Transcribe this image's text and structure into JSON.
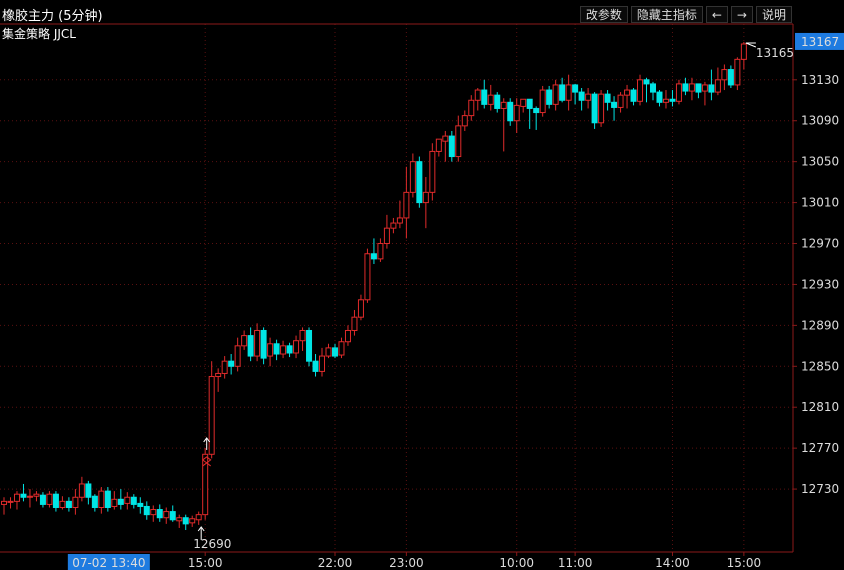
{
  "header": {
    "title": "橡胶主力 (5分钟)",
    "subtitle": "集金策略 JJCL",
    "buttons": [
      "改参数",
      "隐藏主指标",
      "←",
      "→",
      "说明"
    ]
  },
  "colors": {
    "up": "#e02b2b",
    "down": "#00e5e5",
    "axis": "#8b1a1a",
    "text": "#dddddd",
    "price_tag": "#1e7be0"
  },
  "chart_data": {
    "type": "candlestick",
    "y_ticks": [
      12730,
      12770,
      12810,
      12850,
      12890,
      12930,
      12970,
      13010,
      13050,
      13090,
      13130
    ],
    "x_ticks": [
      "15:00",
      "22:00",
      "23:00",
      "10:00",
      "11:00",
      "14:00",
      "15:00"
    ],
    "x_cursor_label": "07-02 13:40",
    "last_price": "13167",
    "annotations": [
      {
        "text": "12690",
        "value": 12690,
        "kind": "low"
      },
      {
        "text": "13165",
        "value": 13165,
        "kind": "high"
      }
    ],
    "ylim": [
      12680,
      13180
    ],
    "candles": [
      [
        12715,
        12718,
        12705,
        12722
      ],
      [
        12717,
        12718,
        12711,
        12722
      ],
      [
        12718,
        12725,
        12710,
        12728
      ],
      [
        12725,
        12722,
        12718,
        12735
      ],
      [
        12722,
        12723,
        12712,
        12730
      ],
      [
        12723,
        12725,
        12718,
        12728
      ],
      [
        12724,
        12715,
        12712,
        12727
      ],
      [
        12715,
        12725,
        12712,
        12728
      ],
      [
        12725,
        12712,
        12708,
        12728
      ],
      [
        12712,
        12718,
        12710,
        12723
      ],
      [
        12718,
        12712,
        12708,
        12722
      ],
      [
        12712,
        12722,
        12705,
        12730
      ],
      [
        12722,
        12735,
        12718,
        12742
      ],
      [
        12735,
        12722,
        12715,
        12738
      ],
      [
        12723,
        12712,
        12708,
        12725
      ],
      [
        12712,
        12728,
        12706,
        12732
      ],
      [
        12728,
        12712,
        12708,
        12732
      ],
      [
        12713,
        12720,
        12710,
        12728
      ],
      [
        12720,
        12715,
        12710,
        12730
      ],
      [
        12716,
        12722,
        12710,
        12727
      ],
      [
        12722,
        12715,
        12711,
        12725
      ],
      [
        12716,
        12713,
        12706,
        12722
      ],
      [
        12713,
        12705,
        12700,
        12718
      ],
      [
        12705,
        12710,
        12698,
        12714
      ],
      [
        12710,
        12702,
        12698,
        12715
      ],
      [
        12702,
        12708,
        12696,
        12712
      ],
      [
        12708,
        12700,
        12698,
        12714
      ],
      [
        12699,
        12702,
        12692,
        12705
      ],
      [
        12702,
        12696,
        12690,
        12705
      ],
      [
        12697,
        12701,
        12693,
        12704
      ],
      [
        12700,
        12705,
        12695,
        12708
      ],
      [
        12705,
        12764,
        12700,
        12770
      ],
      [
        12764,
        12840,
        12760,
        12855
      ],
      [
        12840,
        12843,
        12825,
        12848
      ],
      [
        12843,
        12855,
        12838,
        12860
      ],
      [
        12855,
        12850,
        12842,
        12862
      ],
      [
        12850,
        12870,
        12845,
        12878
      ],
      [
        12870,
        12880,
        12866,
        12885
      ],
      [
        12880,
        12860,
        12855,
        12888
      ],
      [
        12860,
        12885,
        12855,
        12892
      ],
      [
        12885,
        12858,
        12852,
        12888
      ],
      [
        12860,
        12872,
        12850,
        12878
      ],
      [
        12872,
        12862,
        12856,
        12876
      ],
      [
        12862,
        12870,
        12858,
        12875
      ],
      [
        12870,
        12863,
        12859,
        12873
      ],
      [
        12863,
        12875,
        12858,
        12880
      ],
      [
        12875,
        12885,
        12865,
        12888
      ],
      [
        12885,
        12855,
        12850,
        12888
      ],
      [
        12855,
        12845,
        12840,
        12862
      ],
      [
        12845,
        12860,
        12840,
        12868
      ],
      [
        12860,
        12868,
        12858,
        12872
      ],
      [
        12868,
        12860,
        12858,
        12872
      ],
      [
        12861,
        12874,
        12858,
        12878
      ],
      [
        12874,
        12885,
        12870,
        12890
      ],
      [
        12885,
        12898,
        12880,
        12905
      ],
      [
        12898,
        12915,
        12895,
        12920
      ],
      [
        12915,
        12960,
        12912,
        12965
      ],
      [
        12960,
        12955,
        12950,
        12975
      ],
      [
        12955,
        12970,
        12952,
        12975
      ],
      [
        12970,
        12985,
        12965,
        12998
      ],
      [
        12985,
        12990,
        12980,
        12995
      ],
      [
        12990,
        12995,
        12985,
        13012
      ],
      [
        12995,
        13020,
        12975,
        13045
      ],
      [
        13020,
        13050,
        13015,
        13058
      ],
      [
        13050,
        13010,
        13005,
        13055
      ],
      [
        13010,
        13020,
        12985,
        13035
      ],
      [
        13020,
        13060,
        13012,
        13068
      ],
      [
        13060,
        13072,
        13055,
        13072
      ],
      [
        13070,
        13075,
        13050,
        13080
      ],
      [
        13075,
        13055,
        13050,
        13080
      ],
      [
        13055,
        13085,
        13050,
        13095
      ],
      [
        13085,
        13095,
        13080,
        13100
      ],
      [
        13095,
        13110,
        13090,
        13115
      ],
      [
        13110,
        13120,
        13100,
        13122
      ],
      [
        13120,
        13106,
        13102,
        13130
      ],
      [
        13106,
        13115,
        13100,
        13125
      ],
      [
        13115,
        13102,
        13098,
        13118
      ],
      [
        13102,
        13108,
        13060,
        13112
      ],
      [
        13108,
        13090,
        13085,
        13112
      ],
      [
        13090,
        13105,
        13078,
        13112
      ],
      [
        13104,
        13111,
        13098,
        13110
      ],
      [
        13111,
        13102,
        13082,
        13110
      ],
      [
        13102,
        13098,
        13081,
        13104
      ],
      [
        13098,
        13120,
        13094,
        13124
      ],
      [
        13120,
        13106,
        13102,
        13124
      ],
      [
        13106,
        13125,
        13100,
        13130
      ],
      [
        13125,
        13110,
        13108,
        13132
      ],
      [
        13110,
        13125,
        13100,
        13135
      ],
      [
        13125,
        13118,
        13106,
        13126
      ],
      [
        13118,
        13110,
        13100,
        13122
      ],
      [
        13110,
        13116,
        13102,
        13122
      ],
      [
        13116,
        13088,
        13082,
        13118
      ],
      [
        13088,
        13116,
        13084,
        13120
      ],
      [
        13116,
        13108,
        13100,
        13120
      ],
      [
        13108,
        13103,
        13090,
        13114
      ],
      [
        13103,
        13115,
        13098,
        13118
      ],
      [
        13115,
        13120,
        13102,
        13125
      ],
      [
        13120,
        13109,
        13105,
        13122
      ],
      [
        13109,
        13130,
        13105,
        13135
      ],
      [
        13130,
        13126,
        13108,
        13132
      ],
      [
        13126,
        13118,
        13110,
        13128
      ],
      [
        13118,
        13108,
        13104,
        13120
      ],
      [
        13108,
        13111,
        13102,
        13120
      ],
      [
        13111,
        13109,
        13104,
        13120
      ],
      [
        13109,
        13126,
        13106,
        13130
      ],
      [
        13126,
        13119,
        13115,
        13132
      ],
      [
        13119,
        13126,
        13110,
        13132
      ],
      [
        13126,
        13118,
        13112,
        13126
      ],
      [
        13119,
        13125,
        13105,
        13128
      ],
      [
        13125,
        13118,
        13110,
        13140
      ],
      [
        13118,
        13130,
        13115,
        13142
      ],
      [
        13130,
        13140,
        13120,
        13145
      ],
      [
        13140,
        13125,
        13122,
        13144
      ],
      [
        13125,
        13150,
        13120,
        13152
      ],
      [
        13150,
        13165,
        13140,
        13167
      ]
    ],
    "x_tick_index": [
      31,
      51,
      62,
      79,
      88,
      103,
      114
    ],
    "cursor_index": 16
  }
}
